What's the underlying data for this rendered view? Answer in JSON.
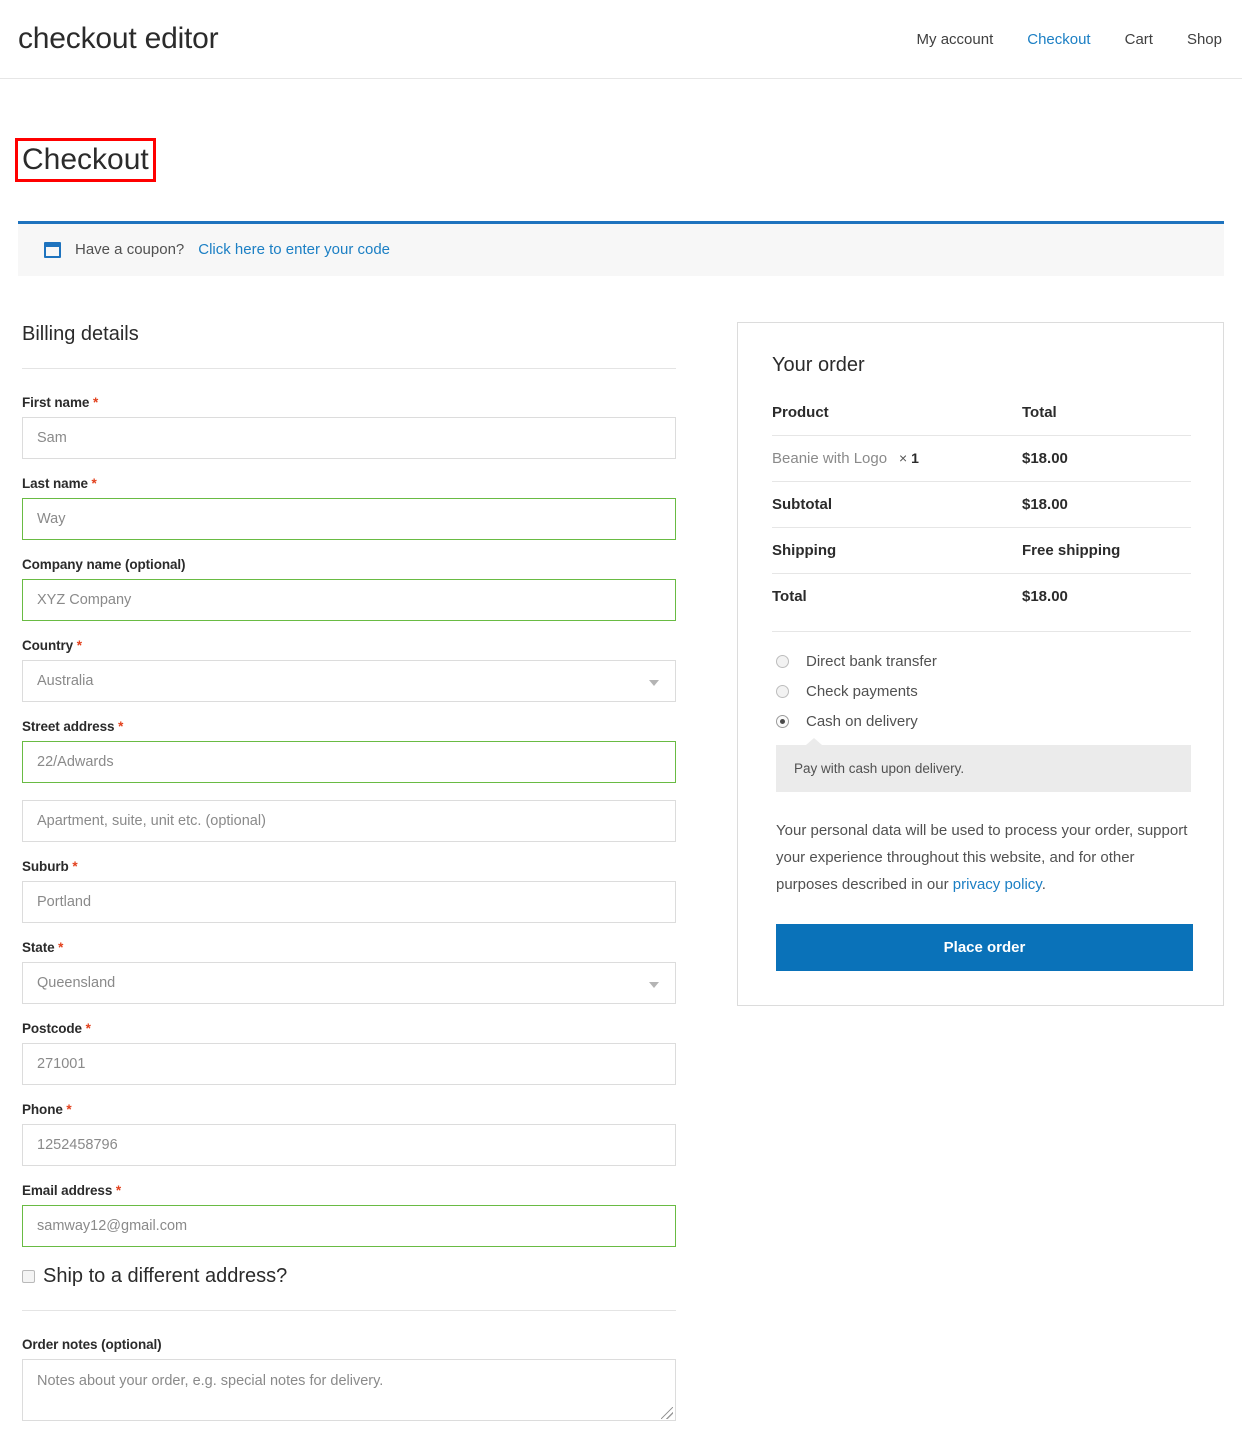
{
  "header": {
    "site_title": "checkout editor",
    "nav": [
      {
        "label": "My account",
        "active": false
      },
      {
        "label": "Checkout",
        "active": true
      },
      {
        "label": "Cart",
        "active": false
      },
      {
        "label": "Shop",
        "active": false
      }
    ]
  },
  "page": {
    "title": "Checkout",
    "highlight_color": "#ff0000"
  },
  "coupon": {
    "icon": "coupon-tag-icon",
    "text": "Have a coupon?",
    "link_label": "Click here to enter your code",
    "accent_color": "#1e73be"
  },
  "billing": {
    "heading": "Billing details",
    "fields": [
      {
        "label": "First name",
        "required": true,
        "value": "Sam",
        "type": "text",
        "valid": false
      },
      {
        "label": "Last name",
        "required": true,
        "value": "Way",
        "type": "text",
        "valid": true
      },
      {
        "label": "Company name (optional)",
        "required": false,
        "value": "XYZ Company",
        "type": "text",
        "valid": true
      },
      {
        "label": "Country",
        "required": true,
        "value": "Australia",
        "type": "select",
        "valid": false
      },
      {
        "label": "Street address",
        "required": true,
        "value": "22/Adwards",
        "type": "text",
        "valid": true
      },
      {
        "label": "",
        "required": false,
        "value": "Apartment, suite, unit etc. (optional)",
        "type": "text",
        "valid": false
      },
      {
        "label": "Suburb",
        "required": true,
        "value": "Portland",
        "type": "text",
        "valid": false
      },
      {
        "label": "State",
        "required": true,
        "value": "Queensland",
        "type": "select",
        "valid": false
      },
      {
        "label": "Postcode",
        "required": true,
        "value": "271001",
        "type": "text",
        "valid": false
      },
      {
        "label": "Phone",
        "required": true,
        "value": "1252458796",
        "type": "text",
        "valid": false
      },
      {
        "label": "Email address",
        "required": true,
        "value": "samway12@gmail.com",
        "type": "text",
        "valid": true
      }
    ],
    "ship_different_label": "Ship to a different address?",
    "ship_different_checked": false,
    "order_notes_label": "Order notes (optional)",
    "order_notes_placeholder": "Notes about your order, e.g. special notes for delivery.",
    "order_notes_value": "",
    "valid_border_color": "#69bb43"
  },
  "order": {
    "heading": "Your order",
    "columns": {
      "product": "Product",
      "total": "Total"
    },
    "items": [
      {
        "name": "Beanie with Logo",
        "times": "×",
        "qty": "1",
        "total": "$18.00"
      }
    ],
    "rows": [
      {
        "label": "Subtotal",
        "value": "$18.00"
      },
      {
        "label": "Shipping",
        "value": "Free shipping"
      },
      {
        "label": "Total",
        "value": "$18.00"
      }
    ],
    "payment_methods": [
      {
        "label": "Direct bank transfer",
        "selected": false
      },
      {
        "label": "Check payments",
        "selected": false
      },
      {
        "label": "Cash on delivery",
        "selected": true
      }
    ],
    "payment_description": "Pay with cash upon delivery.",
    "privacy_text_before": "Your personal data will be used to process your order, support your experience throughout this website, and for other purposes described in our ",
    "privacy_link_label": "privacy policy",
    "privacy_text_after": ".",
    "place_order_label": "Place order",
    "button_color": "#0a72b9"
  }
}
